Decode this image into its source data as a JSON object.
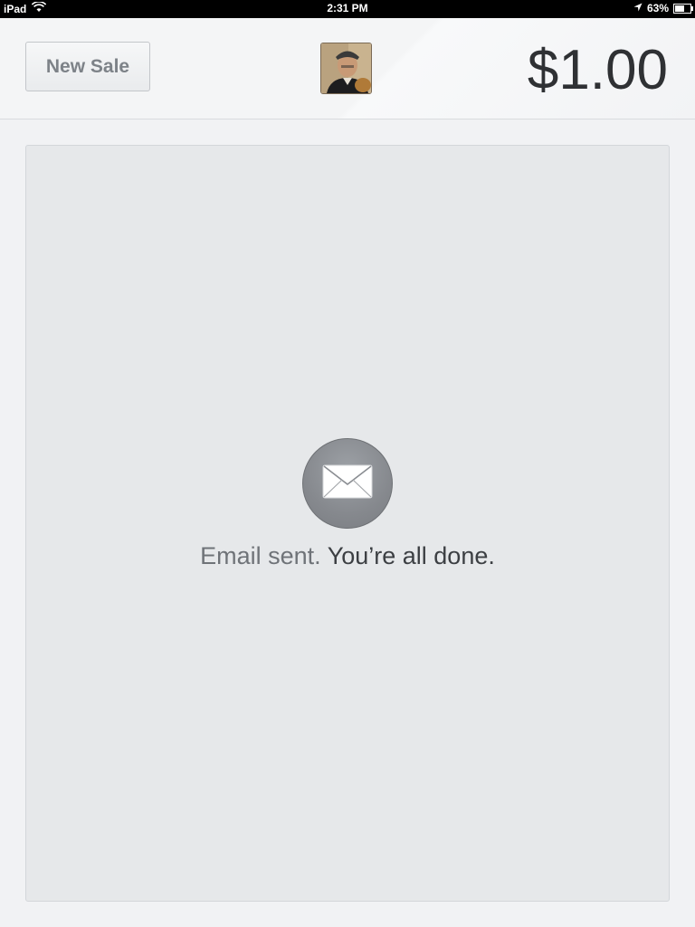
{
  "status_bar": {
    "device": "iPad",
    "time": "2:31 PM",
    "battery": "63%",
    "battery_level": 0.63,
    "icons": [
      "wifi-icon",
      "location-arrow-icon",
      "battery-icon"
    ]
  },
  "header": {
    "new_sale_label": "New Sale",
    "avatar": "user-profile-photo",
    "amount": "$1.00"
  },
  "receipt": {
    "icon": "envelope-icon",
    "message_muted": "Email sent.",
    "message_strong": "You’re all done."
  },
  "colors": {
    "status_bar_bg": "#000000",
    "header_bg": "#f4f5f6",
    "panel_bg": "#e6e8ea",
    "amount_text": "#2f3134",
    "button_text": "#7d8288",
    "icon_circle": "#86898e"
  }
}
